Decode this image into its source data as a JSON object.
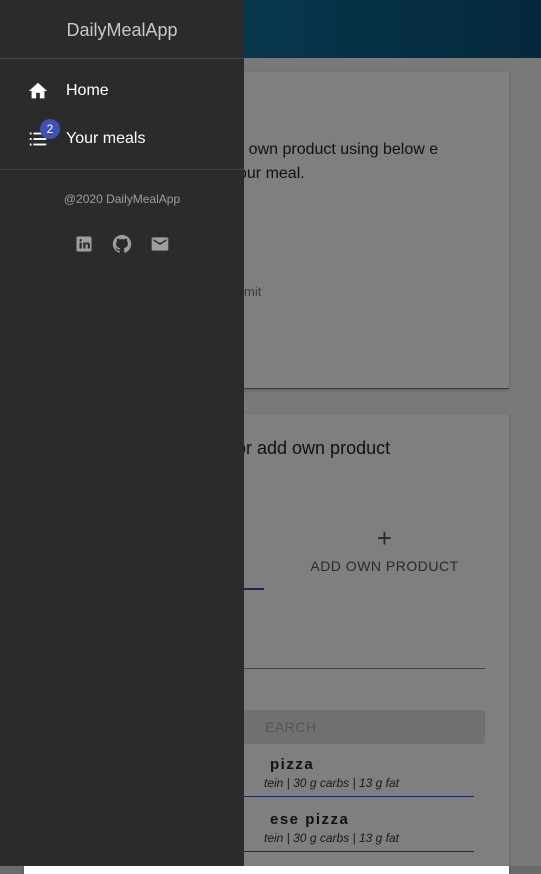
{
  "drawer": {
    "title": "DailyMealApp",
    "items": [
      {
        "label": "Home",
        "icon": "home-icon"
      },
      {
        "label": "Your meals",
        "icon": "list-icon",
        "badge": "2"
      }
    ],
    "copyright": "@2020 DailyMealApp",
    "socials": [
      "linkedin-icon",
      "github-icon",
      "email-icon"
    ]
  },
  "main": {
    "intro": "ur own product using below e your meal.",
    "limit_text": "mit",
    "card2_title": "or add own product",
    "tab_add_label": "ADD OWN PRODUCT",
    "search_button": "EARCH",
    "results": [
      {
        "name": "pizza",
        "meta": "tein | 30 g carbs | 13 g fat"
      },
      {
        "name": "ese pizza",
        "meta": "tein | 30 g carbs | 13 g fat"
      }
    ]
  },
  "colors": {
    "drawer_bg": "#2b2b2b",
    "accent": "#3f51b5",
    "appbar": "#0e6a92"
  }
}
